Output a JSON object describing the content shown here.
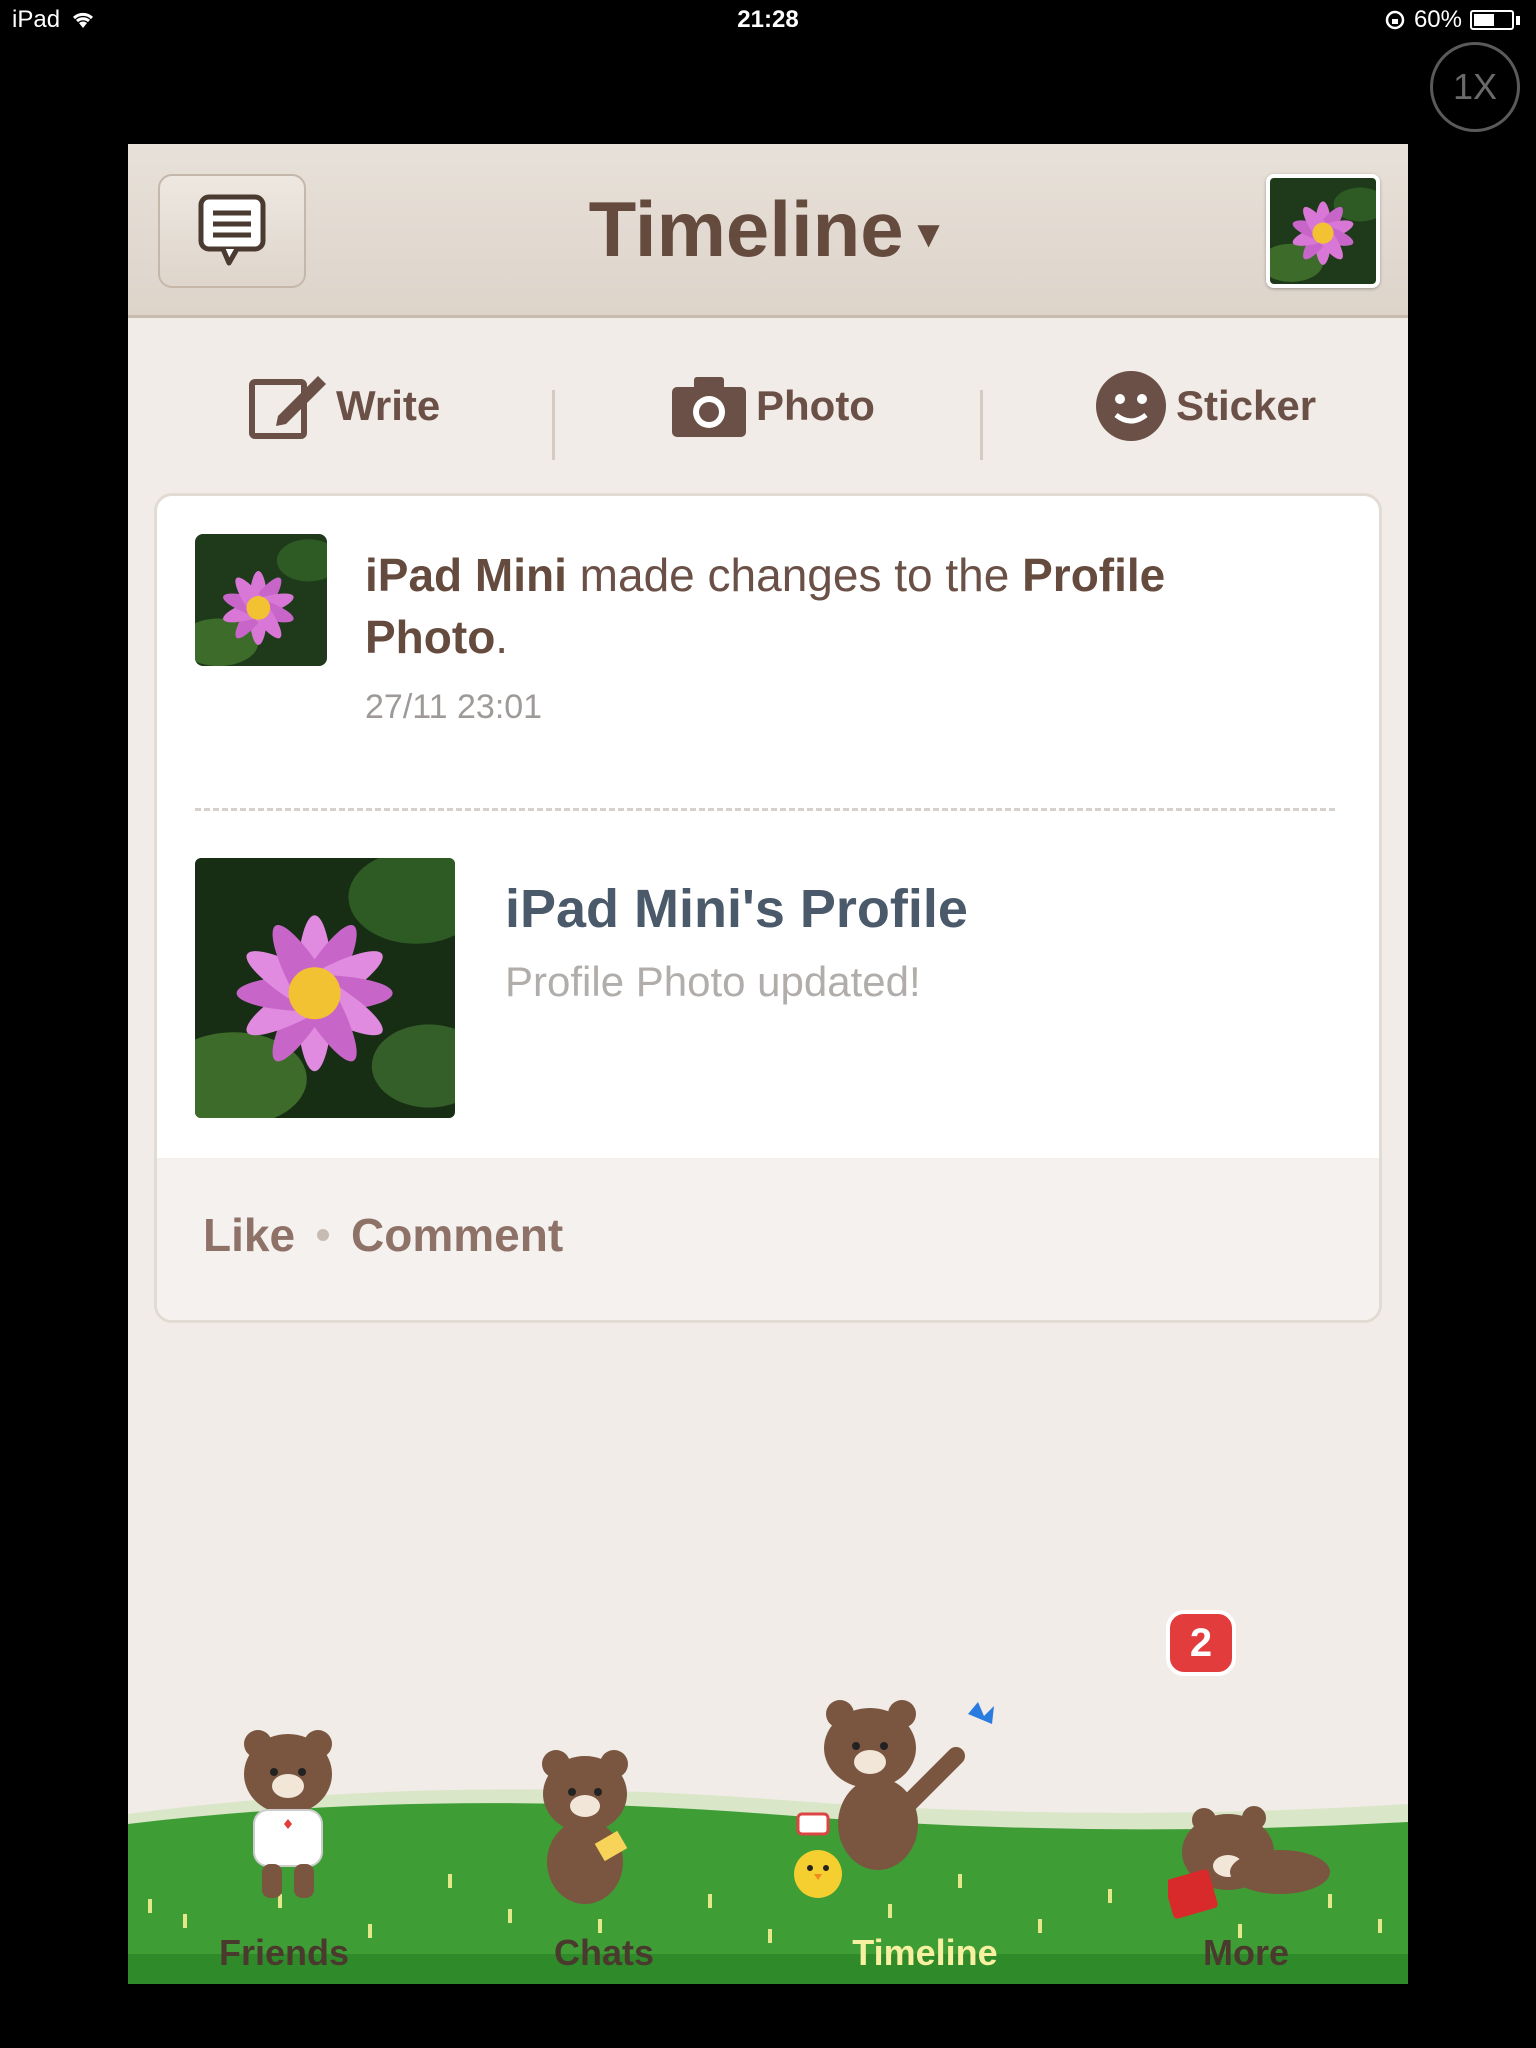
{
  "status_bar": {
    "device": "iPad",
    "time": "21:28",
    "battery": "60%",
    "battery_level": 0.6
  },
  "zoom_button": {
    "label": "1X"
  },
  "header": {
    "title": "Timeline"
  },
  "actions": {
    "write": "Write",
    "photo": "Photo",
    "sticker": "Sticker"
  },
  "post": {
    "author": "iPad Mini",
    "text_middle": " made changes to the ",
    "target": "Profile Photo",
    "text_end": ".",
    "timestamp": "27/11 23:01",
    "profile_title": "iPad Mini's Profile",
    "profile_subtitle": "Profile Photo updated!",
    "like": "Like",
    "comment": "Comment"
  },
  "tabs": [
    {
      "label": "Friends"
    },
    {
      "label": "Chats"
    },
    {
      "label": "Timeline"
    },
    {
      "label": "More"
    }
  ],
  "more_badge": "2",
  "colors": {
    "brown": "#654a3e",
    "grass": "#3a9a33",
    "badge": "#e23c3c",
    "active_tab": "#f6f0a0"
  }
}
